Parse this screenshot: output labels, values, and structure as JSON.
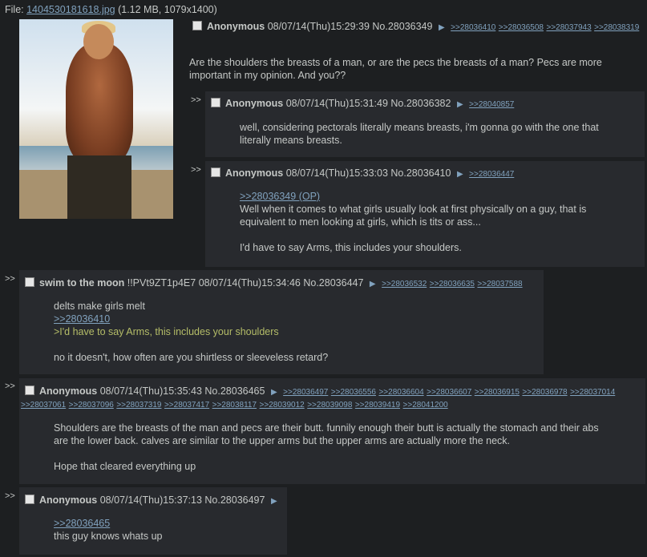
{
  "file": {
    "prefix": "File: ",
    "name": "1404530181618.jpg",
    "meta": " (1.12 MB, 1079x1400)"
  },
  "op": {
    "name": "Anonymous",
    "datetime": "08/07/14(Thu)15:29:39",
    "no": "No.28036349",
    "backlinks": [
      ">>28036410",
      ">>28036508",
      ">>28037943",
      ">>28038319"
    ],
    "body": "Are the shoulders the breasts of a man, or are the pecs the breasts of a man? Pecs are more important in my opinion. And you??"
  },
  "replies": [
    {
      "name": "Anonymous",
      "datetime": "08/07/14(Thu)15:31:49",
      "no": "No.28036382",
      "backlinks": [
        ">>28040857"
      ],
      "lines": [
        "well, considering pectorals literally means breasts, i'm gonna go with the one that literally means breasts."
      ]
    },
    {
      "name": "Anonymous",
      "datetime": "08/07/14(Thu)15:33:03",
      "no": "No.28036410",
      "backlinks": [
        ">>28036447"
      ],
      "quotelink": ">>28036349 (OP)",
      "lines": [
        "Well when it comes to what girls usually look at first physically on a guy, that is equivalent to men looking at girls, which is tits or ass...",
        "I'd have to say Arms, this includes your shoulders."
      ]
    },
    {
      "name": "swim to the moon",
      "trip": "!!PVt9ZT1p4E7",
      "datetime": "08/07/14(Thu)15:34:46",
      "no": "No.28036447",
      "backlinks": [
        ">>28036532",
        ">>28036635",
        ">>28037588"
      ],
      "line1": "delts make girls melt",
      "quotelink": ">>28036410",
      "greentext": ">I'd have to say Arms, this includes your shoulders",
      "line2": "no it doesn't, how often are you shirtless or sleeveless retard?"
    },
    {
      "name": "Anonymous",
      "datetime": "08/07/14(Thu)15:35:43",
      "no": "No.28036465",
      "backlinks": [
        ">>28036497",
        ">>28036556",
        ">>28036604",
        ">>28036607",
        ">>28036915",
        ">>28036978",
        ">>28037014",
        ">>28037061",
        ">>28037096",
        ">>28037319",
        ">>28037417",
        ">>28038117",
        ">>28039012",
        ">>28039098",
        ">>28039419",
        ">>28041200"
      ],
      "line1": "Shoulders are the breasts of the man and pecs are their butt. funnily enough their butt is actually the stomach and their abs are the lower back. calves are similar to the upper arms but the upper arms are actually more the neck.",
      "line2": "Hope that cleared everything up"
    },
    {
      "name": "Anonymous",
      "datetime": "08/07/14(Thu)15:37:13",
      "no": "No.28036497",
      "quotelink": ">>28036465",
      "line1": "this guy knows whats up"
    }
  ],
  "arrow_glyph": ">>",
  "triangle_glyph": "▶"
}
